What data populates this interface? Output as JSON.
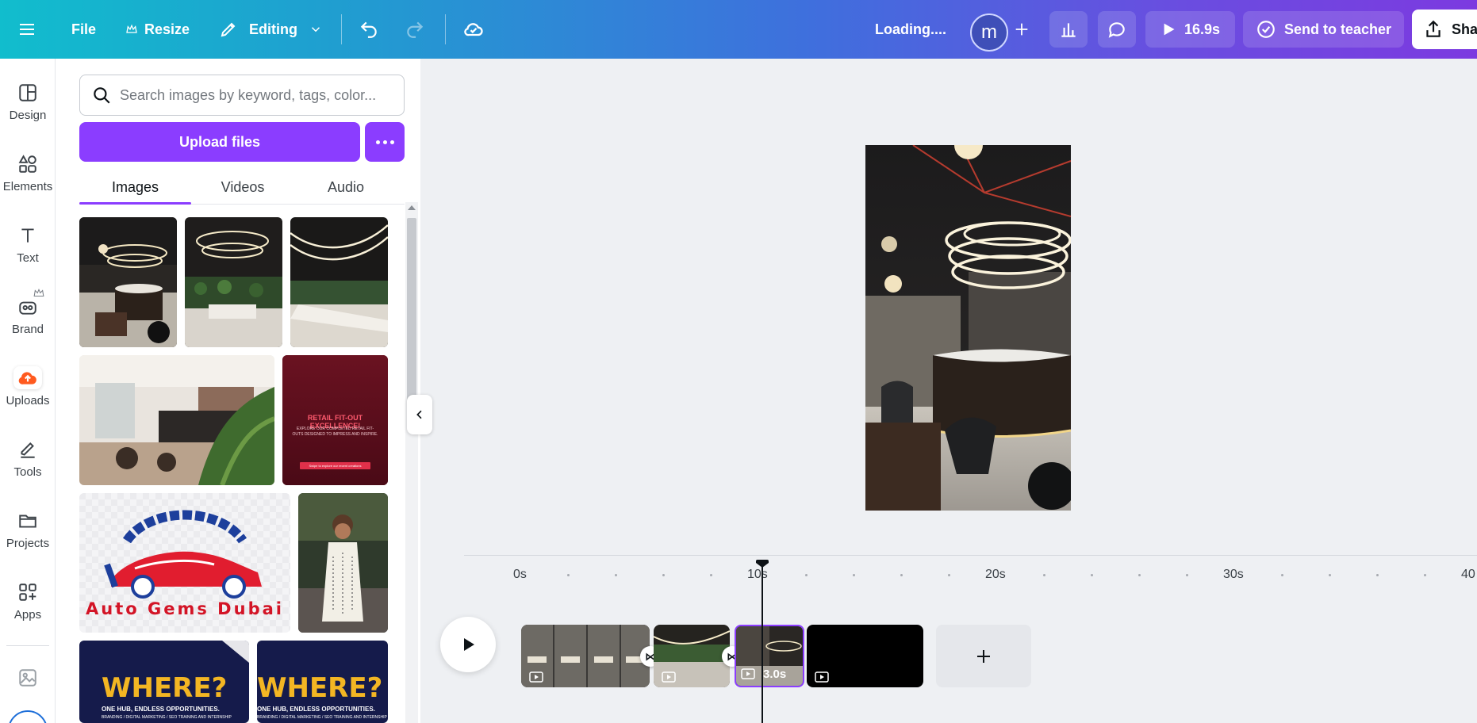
{
  "topbar": {
    "file_label": "File",
    "resize_label": "Resize",
    "editing_label": "Editing",
    "status_text": "Loading....",
    "avatar_initial": "m",
    "play_duration": "16.9s",
    "send_label": "Send to teacher",
    "share_label": "Sha"
  },
  "rail": {
    "items": [
      {
        "label": "Design",
        "icon": "design-icon"
      },
      {
        "label": "Elements",
        "icon": "elements-icon"
      },
      {
        "label": "Text",
        "icon": "text-icon"
      },
      {
        "label": "Brand",
        "icon": "brand-icon"
      },
      {
        "label": "Uploads",
        "icon": "upload-cloud-icon"
      },
      {
        "label": "Tools",
        "icon": "pen-icon"
      },
      {
        "label": "Projects",
        "icon": "folder-icon"
      },
      {
        "label": "Apps",
        "icon": "apps-icon"
      }
    ]
  },
  "panel": {
    "search_placeholder": "Search images by keyword, tags, color...",
    "upload_label": "Upload files",
    "tabs": [
      "Images",
      "Videos",
      "Audio"
    ],
    "active_tab": "Images"
  },
  "thumbnails": {
    "retail_title": "RETAIL FIT-OUT EXCELLENCE!",
    "retail_body": "EXPLORE OUR COMPLETED RETAIL FIT-OUTS DESIGNED TO IMPRESS AND INSPIRE.",
    "retail_cta": "Swipe to explore our recent creations",
    "auto_gems": "Auto Gems Dubai",
    "where_title": "WHERE?",
    "where_sub": "ONE HUB, ENDLESS OPPORTUNITIES.",
    "where_tags": "BRANDING / DIGITAL MARKETING / SEO TRAINING AND INTERNSHIP"
  },
  "timeline": {
    "ticks": [
      "0s",
      "10s",
      "20s",
      "30s",
      "40"
    ],
    "selected_clip_duration": "3.0s"
  },
  "colors": {
    "accent": "#8b3dff",
    "topbar_start": "#11bdcd",
    "topbar_end": "#7c3ae0"
  }
}
